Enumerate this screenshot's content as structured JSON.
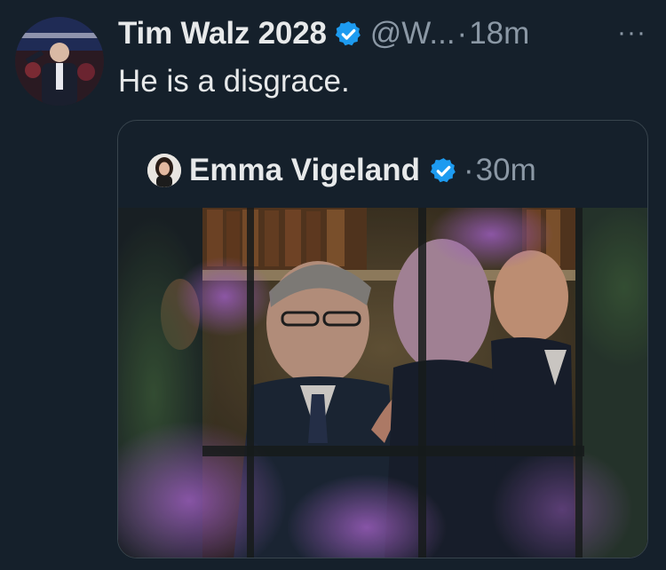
{
  "tweet": {
    "author_name": "Tim Walz 2028",
    "handle": "@W...",
    "separator": "·",
    "time": "18m",
    "text": "He is a disgrace.",
    "more_label": "···"
  },
  "quoted_tweet": {
    "author_name": "Emma Vigeland",
    "separator": "·",
    "time": "30m"
  },
  "colors": {
    "background": "#15202b",
    "verified": "#1d9bf0",
    "secondary_text": "#8b98a5",
    "border": "#38444d"
  },
  "icons": {
    "verified": "verified-badge-icon",
    "more": "more-options-icon"
  }
}
